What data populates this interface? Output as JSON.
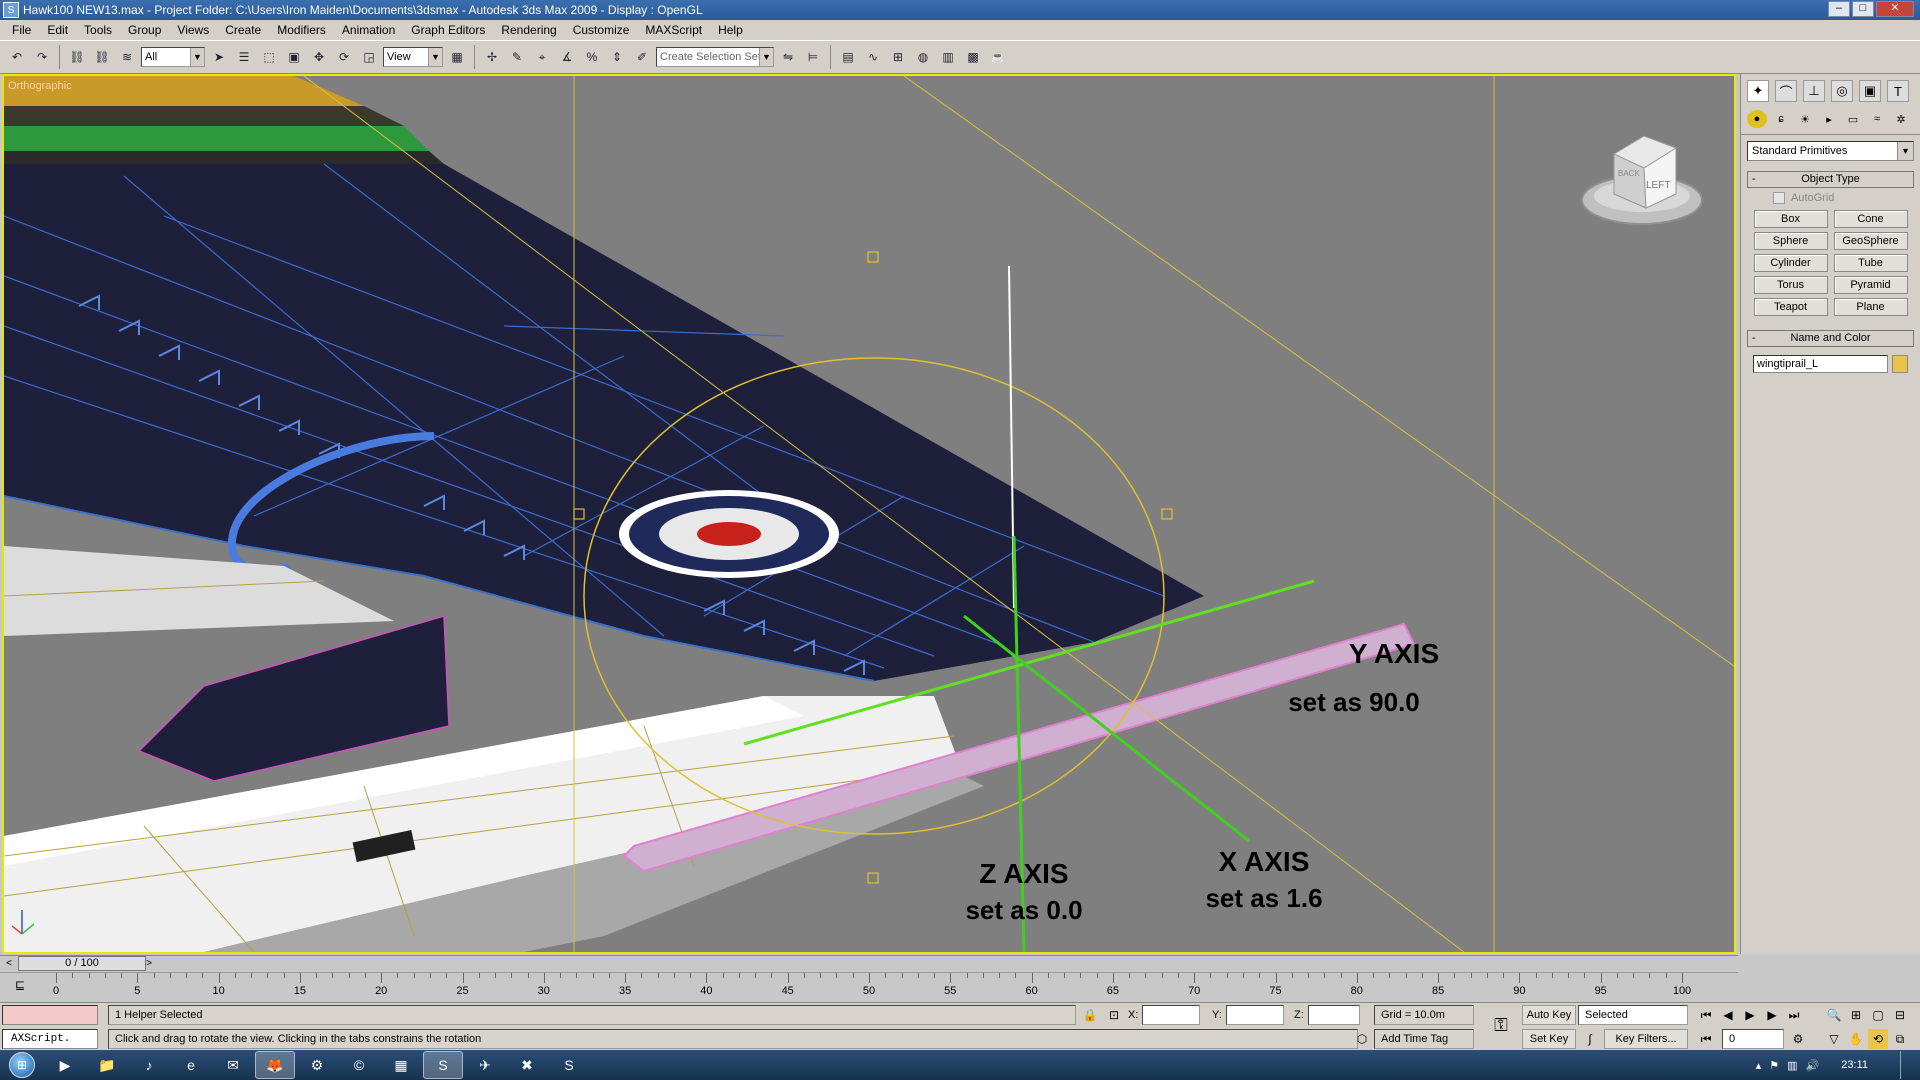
{
  "window": {
    "title": "Hawk100 NEW13.max    - Project Folder: C:\\Users\\Iron Maiden\\Documents\\3dsmax    - Autodesk 3ds Max  2009      - Display : OpenGL",
    "controls": [
      "minimize",
      "maximize",
      "close"
    ]
  },
  "menu": [
    "File",
    "Edit",
    "Tools",
    "Group",
    "Views",
    "Create",
    "Modifiers",
    "Animation",
    "Graph Editors",
    "Rendering",
    "Customize",
    "MAXScript",
    "Help"
  ],
  "toolbar": {
    "selection_filter": "All",
    "ref_coord": "View",
    "named_selection": "Create Selection Set"
  },
  "viewport": {
    "label": "Orthographic",
    "annotations": {
      "y_title": "Y AXIS",
      "y_value": "set as 90.0",
      "x_title": "X AXIS",
      "x_value": "set as 1.6",
      "z_title": "Z AXIS",
      "z_value": "set as 0.0"
    },
    "viewcube_face": "LEFT",
    "viewcube_side": "BACK",
    "colors": {
      "border": "#e8e800",
      "background": "#7f7f7f",
      "wing": "#1e1f3a"
    }
  },
  "command_panel": {
    "category": "Standard Primitives",
    "object_type_title": "Object Type",
    "autogrid": "AutoGrid",
    "primitives": [
      "Box",
      "Cone",
      "Sphere",
      "GeoSphere",
      "Cylinder",
      "Tube",
      "Torus",
      "Pyramid",
      "Teapot",
      "Plane"
    ],
    "name_color_title": "Name and Color",
    "object_name": "wingtiprail_L",
    "object_color": "#e8c44a"
  },
  "timeline": {
    "frame_display": "0 / 100",
    "ticks": [
      "0",
      "5",
      "10",
      "15",
      "20",
      "25",
      "30",
      "35",
      "40",
      "45",
      "50",
      "55",
      "60",
      "65",
      "70",
      "75",
      "80",
      "85",
      "90",
      "95",
      "100"
    ]
  },
  "status": {
    "maxscript_label": "AXScript.",
    "selection_info": "1 Helper Selected",
    "prompt": "Click and drag to rotate the view.  Clicking in the tabs constrains the rotation",
    "x_label": "X:",
    "y_label": "Y:",
    "z_label": "Z:",
    "grid": "Grid = 10.0m",
    "add_time_tag": "Add Time Tag",
    "auto_key": "Auto Key",
    "set_key": "Set Key",
    "key_mode": "Selected",
    "key_filters": "Key Filters...",
    "current_frame": "0"
  },
  "taskbar": {
    "clock": "23:11"
  }
}
